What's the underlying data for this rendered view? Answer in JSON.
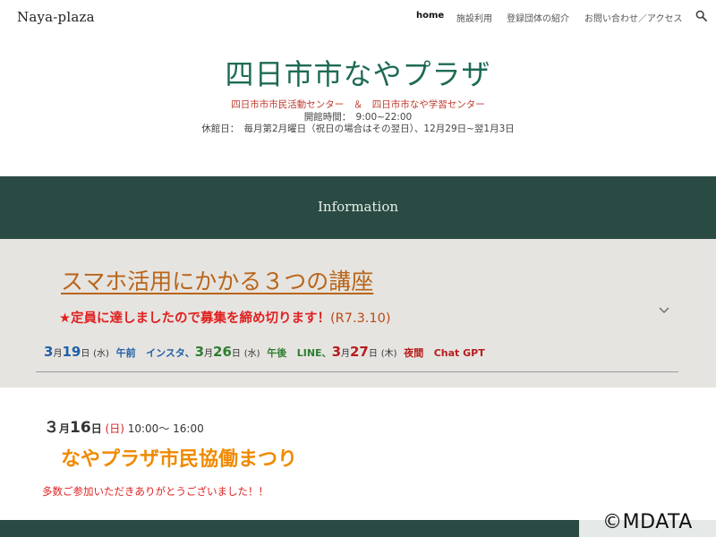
{
  "nav": {
    "logo": "Naya-plaza",
    "links": [
      {
        "label": "home",
        "active": true
      },
      {
        "label": "施設利用",
        "active": false
      },
      {
        "label": "登録団体の紹介",
        "active": false
      },
      {
        "label": "お問い合わせ／アクセス",
        "active": false
      }
    ],
    "search_icon": "search-icon"
  },
  "hero": {
    "title": "四日市市なやプラザ",
    "subtitle": "四日市市市民活動センター　＆　四日市市なや学習センター",
    "hours": "開館時間：　9:00~22:00",
    "closed": "休館日：　毎月第2月曜日（祝日の場合はその翌日）、12月29日~翌1月3日"
  },
  "information": {
    "title": "Information"
  },
  "notice": {
    "title": "スマホ活用にかかる３つの講座",
    "closed_text": "★定員に達しましたので募集を締め切ります！",
    "closed_date": "(R7.3.10)",
    "courses": [
      {
        "month": "3",
        "month_unit": "月",
        "day": "19",
        "day_unit": "日",
        "dow": "(水)",
        "time": "午前",
        "topic": "インスタ、"
      },
      {
        "month": "3",
        "month_unit": "月",
        "day": "26",
        "day_unit": "日",
        "dow": "(水)",
        "time": "午後",
        "topic": "LINE、"
      },
      {
        "month": "3",
        "month_unit": "月",
        "day": "27",
        "day_unit": "日",
        "dow": "(木)",
        "time": "夜間",
        "topic": "Chat GPT"
      }
    ]
  },
  "event": {
    "month": "３",
    "month_unit": "月",
    "day": "16",
    "day_unit": "日",
    "dow": "(日)",
    "time": "10:00～ 16:00",
    "title": "なやプラザ市民協働まつり",
    "thanks": "多数ご参加いただきありがとうございました！！"
  },
  "watermark": "©MDATA",
  "colors": {
    "accent_green": "#1d6a55",
    "band": "#2a4b43",
    "notice_bg": "#e6e4e0",
    "link_orange": "#b8651b",
    "alert_red": "#e02020",
    "event_orange": "#f08a00"
  }
}
